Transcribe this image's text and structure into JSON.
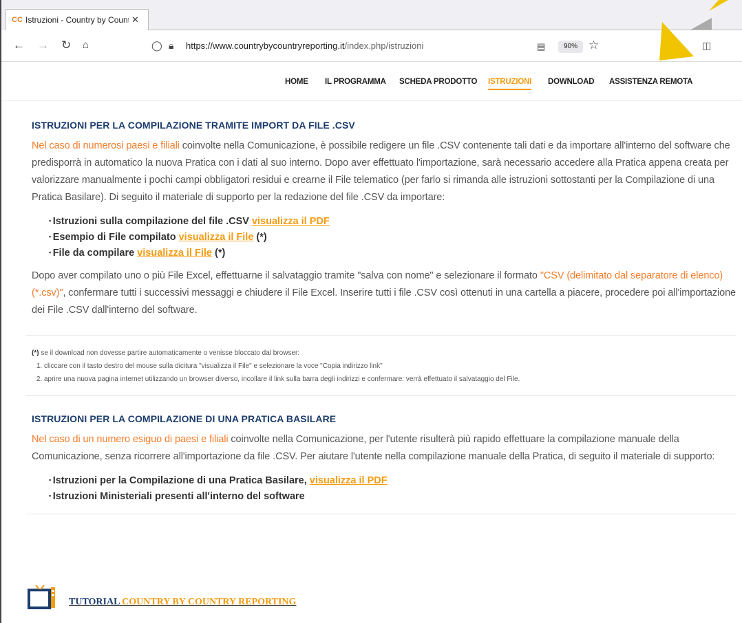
{
  "browser": {
    "tab_title": "Istruzioni - Country by Country",
    "tab_close": "✕",
    "url_domain": "https://www.countrybycountryreporting.it",
    "url_path": "/index.php/istruzioni",
    "zoom": "90%"
  },
  "site_menu": [
    "HOME",
    "IL PROGRAMMA",
    "SCHEDA PRODOTTO",
    "ISTRUZIONI",
    "DOWNLOAD",
    "ASSISTENZA REMOTA"
  ],
  "section1": {
    "title": "ISTRUZIONI PER LA COMPILAZIONE TRAMITE IMPORT DA FILE .CSV",
    "intro_highlight": "Nel caso di numerosi paesi e filiali",
    "intro_text": " coinvolte nella Comunicazione, è possibile redigere un file .CSV contenente tali dati e da importare all'interno del software che predisporrà in automatico la nuova Pratica con i dati al suo interno. Dopo aver effettuato l'importazione, sarà necessario accedere alla Pratica appena creata per valorizzare manualmente i pochi campi obbligatori residui e crearne il File telematico (per farlo si rimanda alle istruzioni sottostanti per la Compilazione di una Pratica Basilare). Di seguito il materiale di supporto per la redazione del file .CSV da importare:",
    "items": [
      {
        "text": "Istruzioni sulla compilazione del file .CSV ",
        "link": "visualizza il PDF",
        "suffix": ""
      },
      {
        "text": "Esempio di File compilato ",
        "link": "visualizza il File",
        "suffix": " (*)"
      },
      {
        "text": "File da compilare ",
        "link": "visualizza il File",
        "suffix": " (*)"
      }
    ],
    "after_a": "Dopo aver compilato uno o più File Excel, effettuarne il salvataggio tramite \"salva con nome\" e selezionare il formato ",
    "after_highlight": "\"CSV (delimitato dal separatore di elenco) (*.csv)\"",
    "after_b": ", confermare tutti i successivi messaggi e chiudere il File Excel. Inserire tutti i file .CSV così ottenuti in una cartella a piacere, procedere poi all'importazione dei File .CSV dall'interno del software."
  },
  "note": {
    "marker": "(*)",
    "text": " se il download non dovesse partire automaticamente o venisse bloccato dal browser:",
    "steps": [
      "cliccare con il tasto destro del mouse sulla dicitura \"visualizza il File\" e selezionare la voce \"Copia indirizzo link\"",
      "aprire una nuova pagina internet utilizzando un browser diverso, incollare il link sulla barra degli indirizzi e confermare: verrà effettuato il salvataggio del File."
    ]
  },
  "section2": {
    "title": "ISTRUZIONI PER LA COMPILAZIONE DI UNA PRATICA BASILARE",
    "intro_highlight": "Nel caso di un numero esiguo di paesi e filiali",
    "intro_text": " coinvolte nella Comunicazione, per l'utente risulterà più rapido effettuare la compilazione manuale della Comunicazione, senza ricorrere all'importazione da file .CSV. Per aiutare l'utente nella compilazione manuale della Pratica, di seguito il materiale di supporto:",
    "items": [
      {
        "text": "Istruzioni per la Compilazione di una Pratica Basilare, ",
        "link": "visualizza il PDF"
      },
      {
        "text": "Istruzioni Ministeriali presenti all'interno del software",
        "link": ""
      }
    ]
  },
  "tutorial": {
    "part1": "TUTORIAL",
    "part2": " COUNTRY BY COUNTRY REPORTING"
  },
  "colors": {
    "accent": "#f39c12",
    "heading": "#1d3d6e",
    "highlight": "#f57c2a"
  }
}
